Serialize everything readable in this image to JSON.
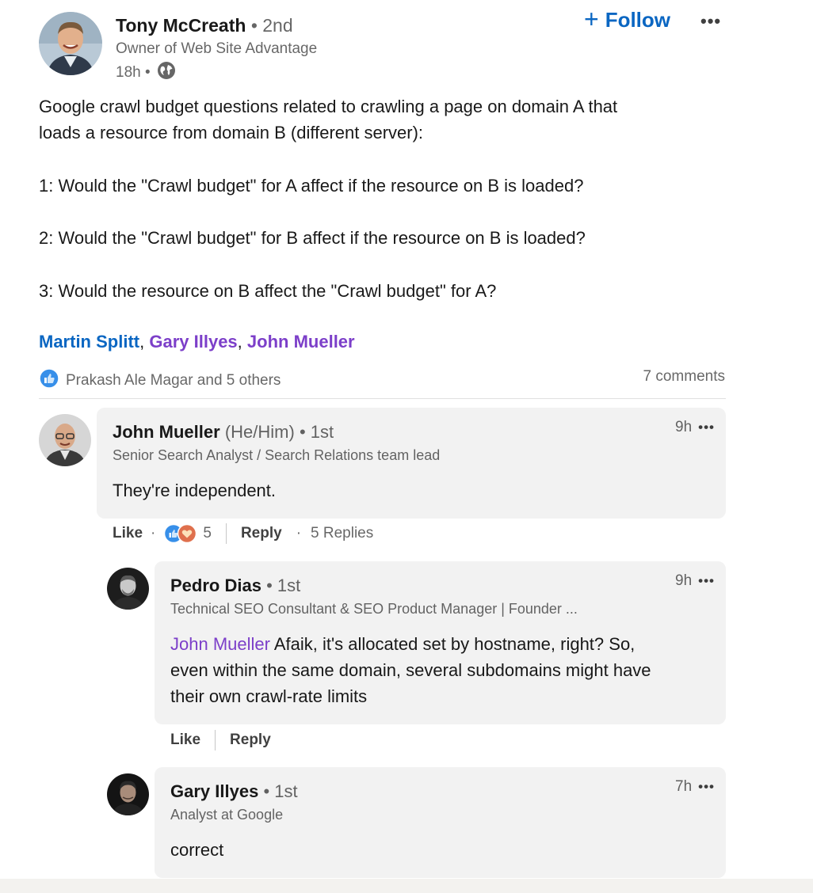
{
  "post": {
    "author": {
      "name": "Tony McCreath",
      "degree": "• 2nd",
      "headline": "Owner of Web Site Advantage",
      "time": "18h •",
      "visibility_icon": "globe-icon"
    },
    "follow_label": "Follow",
    "follow_icon": "plus-icon",
    "more_icon": "more-options-icon",
    "more_label": "•••",
    "body": {
      "line1": "Google crawl budget questions related to crawling a page on domain A that",
      "line2": "loads a resource from domain B (different server):",
      "q1": "1: Would the \"Crawl budget\" for A affect if the resource on B is loaded?",
      "q2": "2: Would the \"Crawl budget\" for B affect if the resource on B is loaded?",
      "q3": "3: Would the resource on B affect the \"Crawl budget\" for A?"
    },
    "mentions": {
      "first": "Martin Splitt",
      "second": "Gary Illyes",
      "third": "John Mueller",
      "separator": ","
    },
    "reactions_text": "Prakash Ale Magar and 5 others",
    "reactions_icon": "like-reaction-icon",
    "comments_count": "7 comments"
  },
  "comments": {
    "c1": {
      "name": "John Mueller",
      "pronouns": "(He/Him)",
      "degree": "• 1st",
      "headline": "Senior Search Analyst / Search Relations team lead",
      "text": "They're independent.",
      "time": "9h",
      "like_label": "Like",
      "reaction_count": "5",
      "reply_label": "Reply",
      "replies_label": "5 Replies",
      "dot": "·"
    },
    "r1": {
      "name": "Pedro Dias",
      "degree": "• 1st",
      "headline": "Technical SEO Consultant & SEO Product Manager | Founder ...",
      "mention": "John Mueller",
      "text_line1": " Afaik, it's allocated set by hostname, right? So,",
      "text_line2": "even within the same domain, several subdomains might have",
      "text_line3": "their own crawl-rate limits",
      "time": "9h",
      "like_label": "Like",
      "reply_label": "Reply"
    },
    "r2": {
      "name": "Gary Illyes",
      "degree": "• 1st",
      "headline": "Analyst at Google",
      "text": "correct",
      "time": "7h"
    }
  },
  "colors": {
    "link_blue": "#0a66c2",
    "mention_purple": "#7c3fc9",
    "bubble_bg": "#f2f2f2"
  }
}
